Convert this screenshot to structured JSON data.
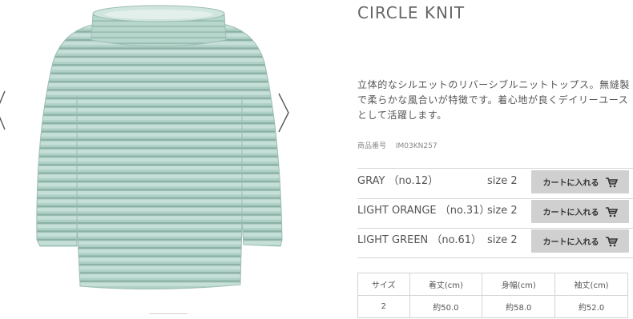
{
  "product": {
    "title": "CIRCLE KNIT",
    "description": "立体的なシルエットのリバーシブルニットトップス。無縫製で柔らかな風合いが特徴です。着心地が良くデイリーユースとして活躍します。",
    "code_label": "商品番号",
    "code": "IM03KN257"
  },
  "variants": [
    {
      "color": "GRAY （no.12）",
      "size": "size 2",
      "cart_label": "カートに入れる"
    },
    {
      "color": "LIGHT ORANGE （no.31）",
      "size": "size 2",
      "cart_label": "カートに入れる"
    },
    {
      "color": "LIGHT GREEN （no.61）",
      "size": "size 2",
      "cart_label": "カートに入れる"
    }
  ],
  "size_table": {
    "headers": [
      "サイズ",
      "着丈(cm)",
      "身幅(cm)",
      "袖丈(cm)"
    ],
    "rows": [
      [
        "2",
        "約50.0",
        "約58.0",
        "約52.0"
      ]
    ]
  },
  "icons": {
    "prev": "chevron-left-icon",
    "next": "chevron-right-icon",
    "cart": "cart-icon"
  },
  "colors": {
    "knit": "#a9cbc1",
    "knit_dark": "#8fb3a9",
    "button_bg": "#d0d0d0",
    "border": "#d6d6d6"
  }
}
